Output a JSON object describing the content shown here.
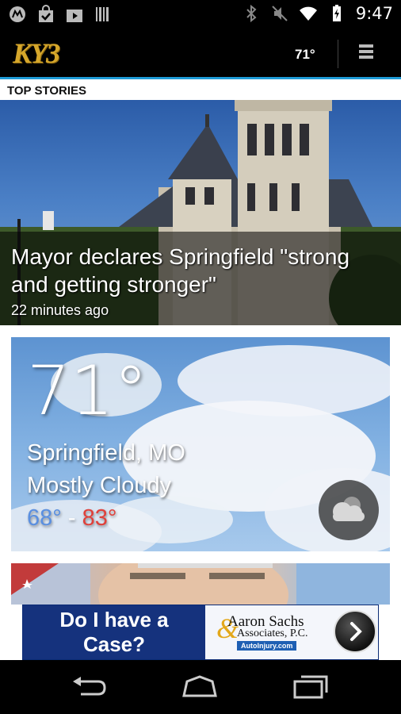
{
  "status_bar": {
    "time": "9:47",
    "left_icons": [
      "motorola-icon",
      "shopping-bag-icon",
      "play-store-icon",
      "barcode-icon"
    ],
    "right_icons": [
      "bluetooth-icon",
      "mute-icon",
      "wifi-icon",
      "battery-icon"
    ]
  },
  "app_bar": {
    "logo": "KY3",
    "temperature": "71°",
    "menu_icon": "overflow-menu-icon"
  },
  "section": {
    "title": "TOP STORIES"
  },
  "top_story": {
    "headline": "Mayor declares Springfield \"strong and getting stronger\"",
    "time_ago": "22 minutes ago"
  },
  "weather": {
    "temperature": "71°",
    "location": "Springfield, MO",
    "condition": "Mostly Cloudy",
    "low": "68°",
    "separator": "-",
    "high": "83°",
    "icon": "cloudy-icon",
    "low_color": "#5a8fe0",
    "high_color": "#e0403a"
  },
  "ad": {
    "left_text_line1": "Do I have a",
    "left_text_line2": "Case?",
    "firm_line1": "Aaron Sachs",
    "firm_line2": "Associates, P.C.",
    "url": "AutoInjury.com",
    "arrow_icon": "chevron-right-icon"
  },
  "nav_bar": {
    "buttons": [
      "back-icon",
      "home-icon",
      "recents-icon"
    ]
  }
}
